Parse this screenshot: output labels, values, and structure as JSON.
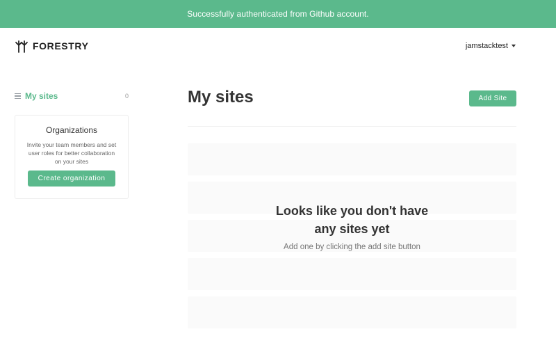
{
  "banner": {
    "message": "Successfully authenticated from Github account."
  },
  "header": {
    "logo_text": "FORESTRY",
    "username": "jamstacktest"
  },
  "sidebar": {
    "items": [
      {
        "label": "My sites",
        "count": "0",
        "icon": "list-icon"
      }
    ],
    "organizations": {
      "title": "Organizations",
      "description": "Invite your team members and set user roles for better collaboration on your sites",
      "button_label": "Create organization"
    }
  },
  "main": {
    "title": "My sites",
    "add_button_label": "Add Site",
    "empty_state": {
      "heading_line1": "Looks like you don't have",
      "heading_line2": "any sites yet",
      "subtext": "Add one by clicking the add site button"
    }
  },
  "colors": {
    "accent": "#5bb98c",
    "placeholder": "#fafafa"
  }
}
